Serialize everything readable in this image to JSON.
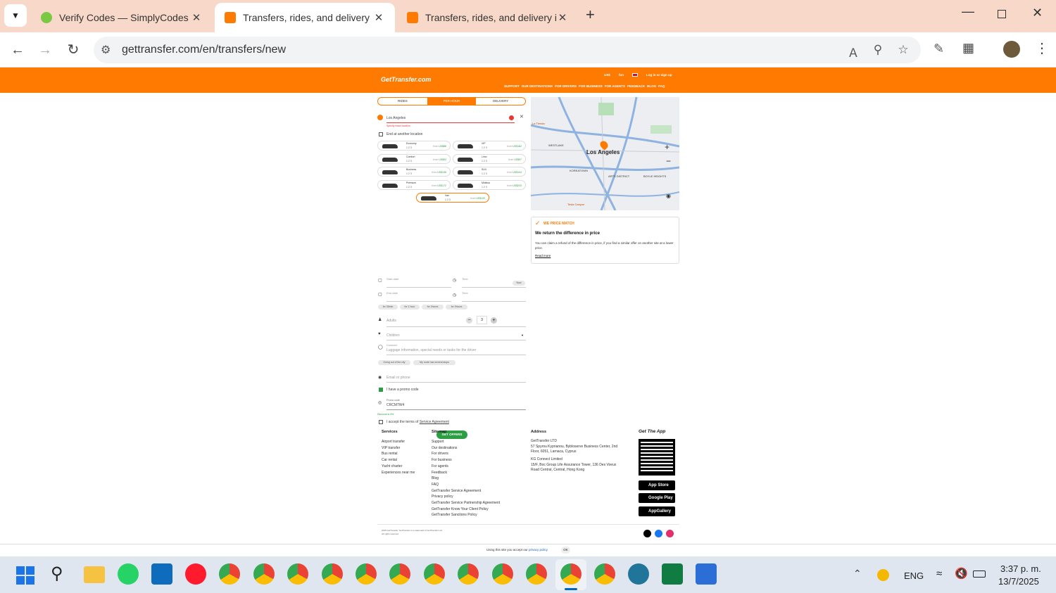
{
  "browser": {
    "tabs": [
      {
        "title": "Verify Codes — SimplyCodes",
        "active": false
      },
      {
        "title": "Transfers, rides, and delivery in",
        "active": true
      },
      {
        "title": "Transfers, rides, and delivery in",
        "active": false
      }
    ],
    "url": "gettransfer.com/en/transfers/new"
  },
  "site": {
    "logo": "GetTransfer.com",
    "top_links": {
      "currency": "US$",
      "lang": "fun",
      "login": "Log in or sign up"
    },
    "nav": [
      "SUPPORT",
      "OUR DESTINATIONS",
      "FOR DRIVERS",
      "FOR BUSINESS",
      "FOR AGENTS",
      "FEEDBACK",
      "BLOG",
      "FAQ"
    ]
  },
  "form": {
    "modes": [
      "RIDES",
      "PER HOUR",
      "DELIVERY"
    ],
    "location": "Los Angeles",
    "location_error": "Specify exact location",
    "end_other": "End at another location",
    "cars": [
      {
        "name": "Economy",
        "icons": "1 2 3",
        "price": "US$88"
      },
      {
        "name": "VIP",
        "icons": "1 2 3",
        "price": "US$182"
      },
      {
        "name": "Comfort",
        "icons": "1 2 3",
        "price": "US$92"
      },
      {
        "name": "Limo",
        "icons": "1 2 3",
        "price": "US$97"
      },
      {
        "name": "Business",
        "icons": "1 2 3",
        "price": "US$136"
      },
      {
        "name": "SUV",
        "icons": "1 2 3",
        "price": "US$104"
      },
      {
        "name": "Premium",
        "icons": "1 2 3",
        "price": "US$172"
      },
      {
        "name": "Minibus",
        "icons": "1 2 3",
        "price": "US$203"
      },
      {
        "name": "Van",
        "icons": "1 2 3",
        "price": "US$120"
      }
    ],
    "from_label": "from",
    "start_date": "Start date",
    "time_label": "Time",
    "now_label": "Now",
    "end_date": "End date",
    "end_time": "Time",
    "durations": [
      "for 30min",
      "for 1 hour",
      "for 2hours",
      "for 3hours"
    ],
    "adults_label": "Adults",
    "adults_value": "3",
    "children_label": "Children",
    "comment_label": "Comment",
    "comment_placeholder": "Luggage information, special needs or tasks for the driver",
    "comment_chips": [
      "Going out of the city",
      "My route has several stops"
    ],
    "email_placeholder": "Email or phone",
    "promo_check": "I have a promo code",
    "promo_label": "Promo code",
    "promo_value": "CRCM7W4",
    "discount": "Discount is 3%",
    "terms_text": "I accept the terms of",
    "terms_link": "Service Agreement",
    "submit": "GET OFFERS"
  },
  "map": {
    "city": "Los Angeles",
    "labels": [
      "La Tienda",
      "WESTLAKE",
      "KOREATOWN",
      "ARTS DISTRICT",
      "BOYLE HEIGHTS",
      "Tesla Canyon"
    ]
  },
  "price_match": {
    "badge": "WE PRICE MATCH",
    "title": "We return the difference in price",
    "body": "You can claim a refund of the difference in price, if you find a similar offer on another site at a lower price.",
    "link": "Read more"
  },
  "footer": {
    "services_title": "Services",
    "services": [
      "Airport transfer",
      "VIP transfer",
      "Bus rental",
      "Car rental",
      "Yacht charter",
      "Experiences near me"
    ],
    "sitemap_title": "Sitemap",
    "sitemap": [
      "Support",
      "Our destinations",
      "For drivers",
      "For business",
      "For agents",
      "Feedback",
      "Blog",
      "FAQ",
      "GetTransfer Service Agreement",
      "Privacy policy",
      "GetTransfer Service Partnership Agreement",
      "GetTransfer Know Your Client Policy",
      "GetTransfer Sanctions Policy"
    ],
    "address_title": "Address",
    "address_1": [
      "GetTransfer LTD",
      "57 Spyrou Kyprianou, Bybloserve Business Center, 2nd",
      "Floor, 6051, Larnaca, Cyprus"
    ],
    "address_2": [
      "KG Connect Limited",
      "15/F, Boc Group Life Assurance Tower, 136 Des Voeux",
      "Road Central, Central, Hong Kong"
    ],
    "app_title": "Get The App",
    "stores": [
      "App Store",
      "Google Play",
      "AppGallery"
    ],
    "copyright": [
      "2025 GetTransfer. GetTransfer is a trademark of GetTransfer Ltd.",
      "All rights reserved"
    ],
    "cookie_text": "Using this site you accept our",
    "cookie_link": "privacy policy",
    "cookie_ok": "OK"
  },
  "taskbar": {
    "lang": "ENG",
    "time": "3:37 p. m.",
    "date": "13/7/2025"
  }
}
